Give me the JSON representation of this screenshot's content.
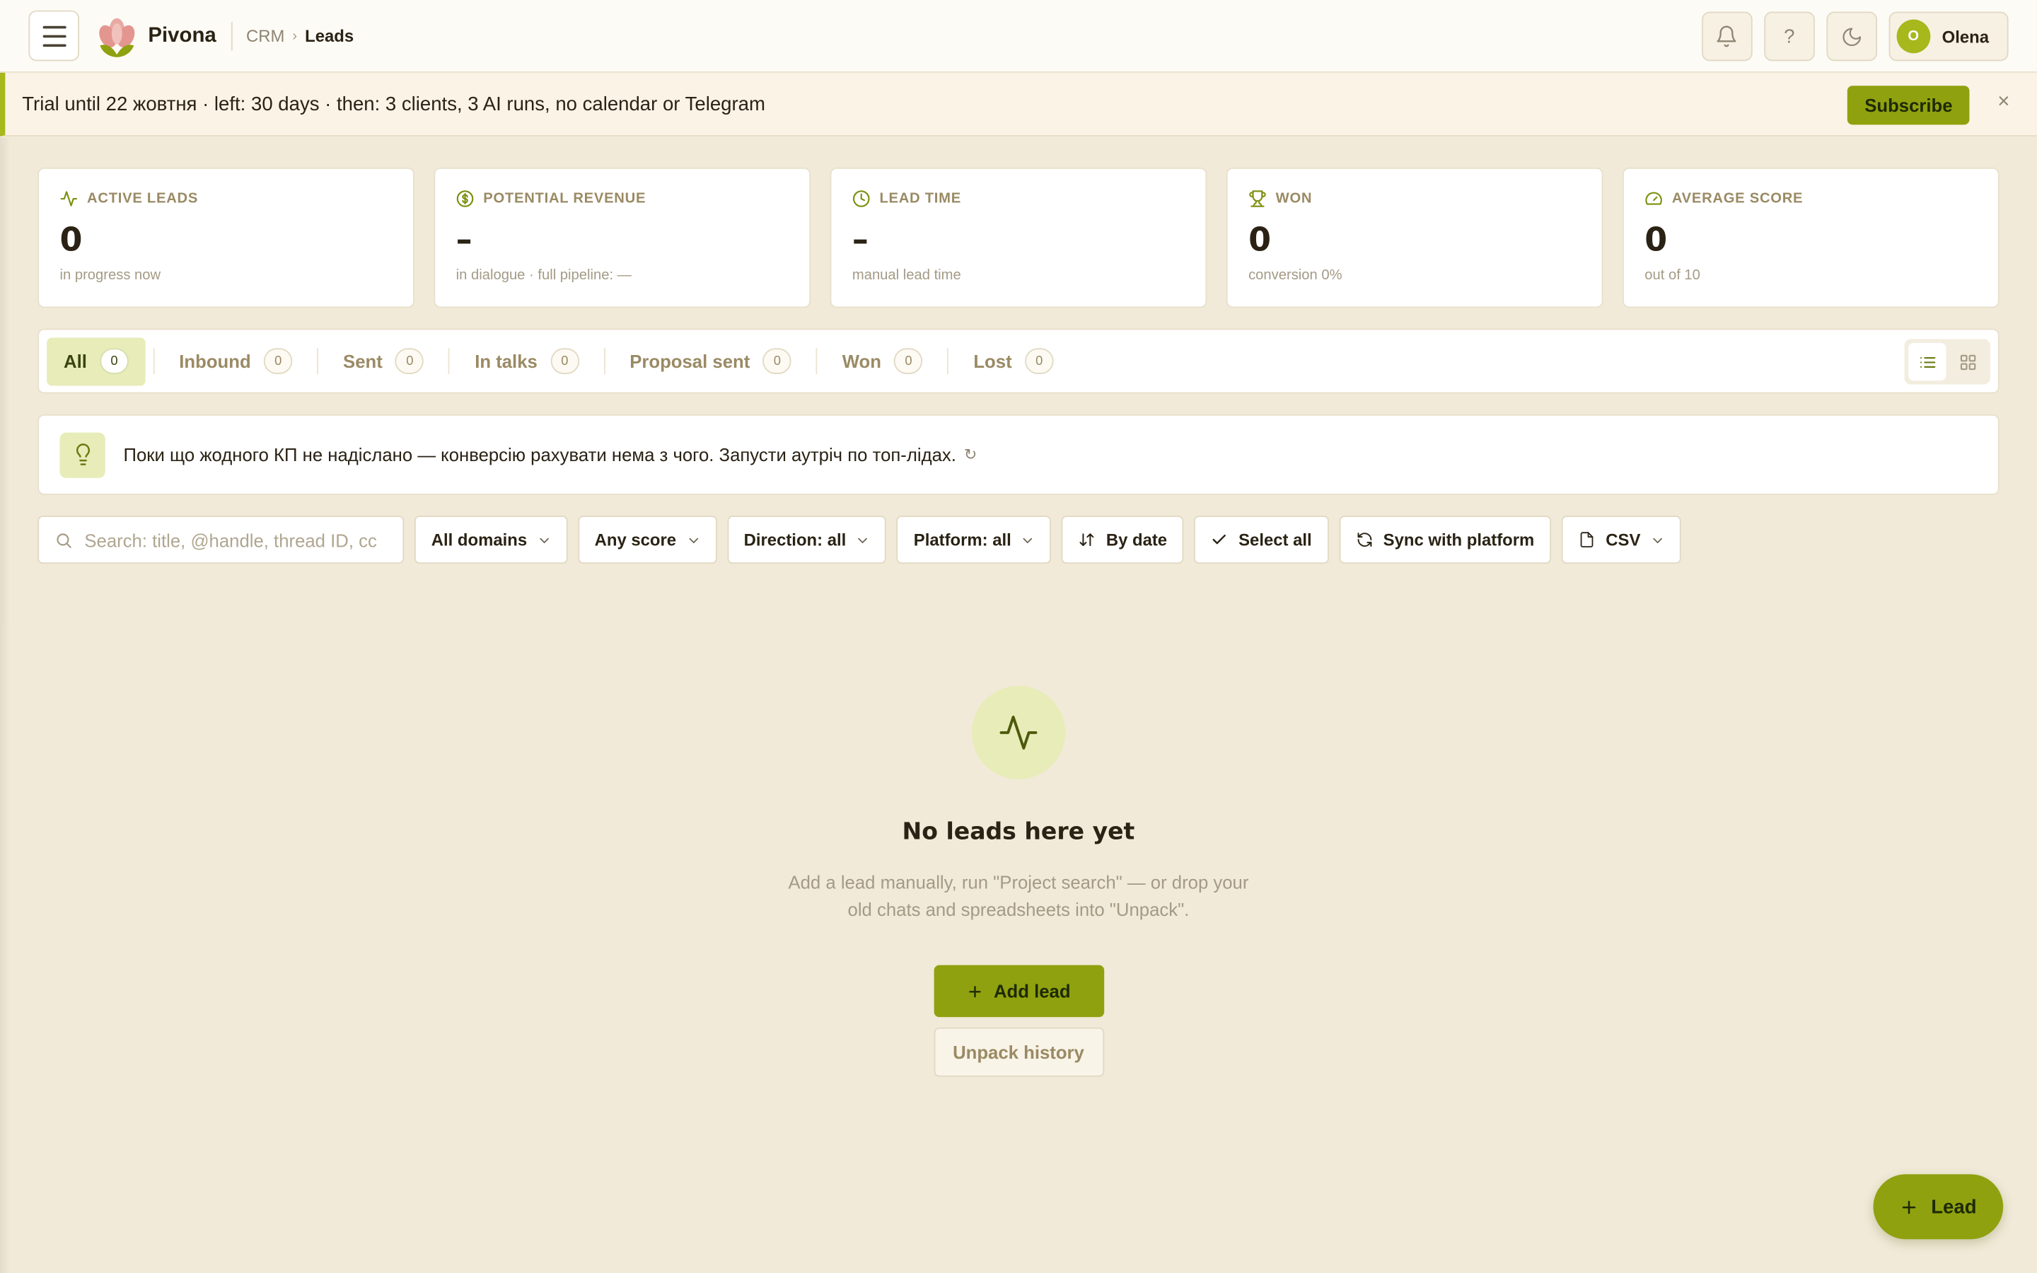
{
  "app": {
    "name": "Pivona"
  },
  "breadcrumb": {
    "section": "CRM",
    "separator": "›",
    "page": "Leads"
  },
  "header": {
    "help_label": "?",
    "user_initial": "O",
    "user_name": "Olena"
  },
  "banner": {
    "text": "Trial until 22 жовтня · left: 30 days · then: 3 clients, 3 AI runs, no calendar or Telegram",
    "subscribe_label": "Subscribe",
    "close_label": "×"
  },
  "stats": [
    {
      "icon": "activity-icon",
      "label": "ACTIVE LEADS",
      "value": "0",
      "sub": "in progress now"
    },
    {
      "icon": "dollar-icon",
      "label": "POTENTIAL REVENUE",
      "value": "–",
      "sub": "in dialogue · full pipeline: —"
    },
    {
      "icon": "clock-icon",
      "label": "LEAD TIME",
      "value": "–",
      "sub": "manual lead time"
    },
    {
      "icon": "trophy-icon",
      "label": "WON",
      "value": "0",
      "sub": "conversion 0%"
    },
    {
      "icon": "gauge-icon",
      "label": "AVERAGE SCORE",
      "value": "0",
      "sub": "out of 10"
    }
  ],
  "tabs": [
    {
      "label": "All",
      "count": "0",
      "active": true
    },
    {
      "label": "Inbound",
      "count": "0"
    },
    {
      "label": "Sent",
      "count": "0"
    },
    {
      "label": "In talks",
      "count": "0"
    },
    {
      "label": "Proposal sent",
      "count": "0"
    },
    {
      "label": "Won",
      "count": "0"
    },
    {
      "label": "Lost",
      "count": "0"
    }
  ],
  "hint": {
    "text": "Поки що жодного КП не надіслано — конверсію рахувати нема з чого. Запусти аутріч по топ-лідах.",
    "refresh": "↻"
  },
  "filters": {
    "search_placeholder": "Search: title, @handle, thread ID, cc",
    "search_value": "",
    "domains": "All domains",
    "score": "Any score",
    "direction": "Direction: all",
    "platform": "Platform: all",
    "sort": "By date",
    "select_all": "Select all",
    "sync": "Sync with platform",
    "csv": "CSV"
  },
  "empty": {
    "title": "No leads here yet",
    "description": "Add a lead manually, run \"Project search\" — or drop your old chats and spreadsheets into \"Unpack\".",
    "add_label": "Add lead",
    "unpack_label": "Unpack history"
  },
  "fab": {
    "label": "Lead"
  },
  "colors": {
    "accent": "#8fa10f",
    "accent_soft": "#e7ecb9",
    "background": "#f1ead8"
  }
}
